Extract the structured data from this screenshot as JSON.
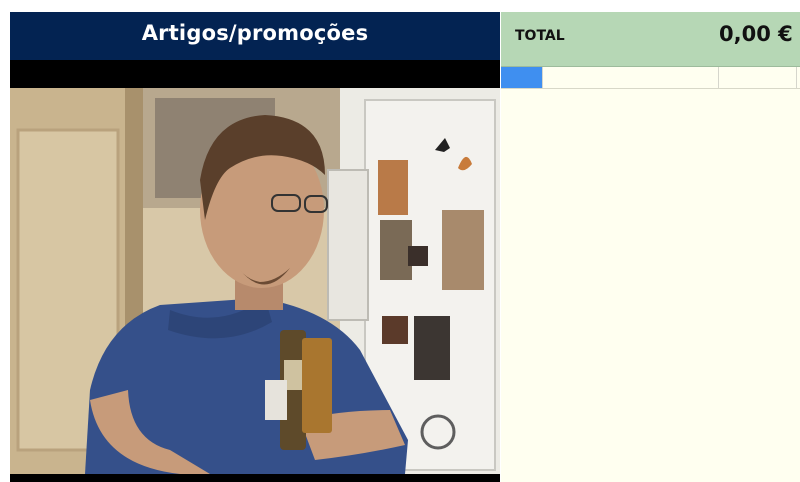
{
  "left_panel": {
    "title": "Artigos/promoções"
  },
  "right_panel": {
    "total_label": "TOTAL",
    "total_value": "0,00 €"
  },
  "colors": {
    "header_bg": "#032352",
    "total_bg": "#b6d7b5",
    "list_bg": "#fffff0",
    "selection": "#3f8ff0"
  }
}
